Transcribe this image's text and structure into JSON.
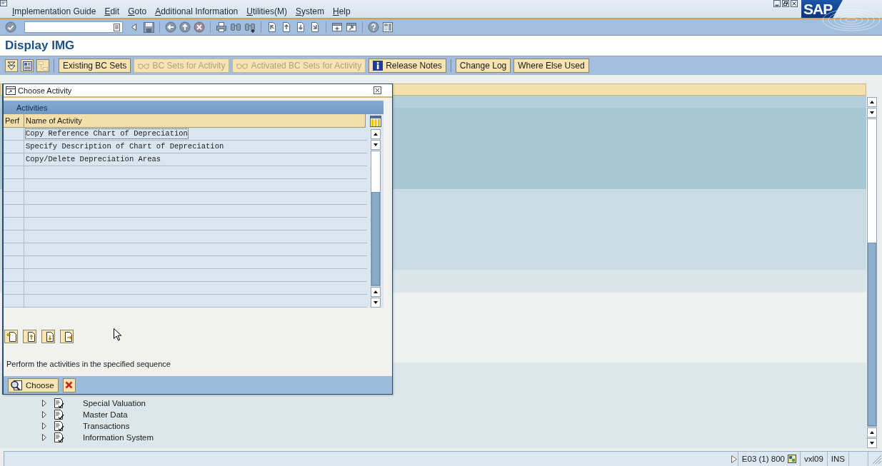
{
  "window": {
    "title": "Display IMG"
  },
  "menu_bar": {
    "items": [
      "Implementation Guide",
      "Edit",
      "Goto",
      "Additional Information",
      "Utilities(M)",
      "System",
      "Help"
    ]
  },
  "logo": {
    "text": "SAP"
  },
  "app_toolbar": {
    "groups": [
      {
        "buttons": [
          {
            "kind": "triangles",
            "disabled": false
          },
          {
            "kind": "list",
            "disabled": false
          },
          {
            "kind": "hierarchy",
            "disabled": true
          }
        ]
      },
      {
        "buttons": [
          {
            "kind": "text",
            "label": "Existing BC Sets",
            "disabled": false
          },
          {
            "kind": "bc-set",
            "label": "BC Sets for Activity",
            "disabled": true
          },
          {
            "kind": "bc-set",
            "label": "Activated BC Sets for Activity",
            "disabled": true
          },
          {
            "kind": "info",
            "label": "Release Notes",
            "disabled": false
          }
        ]
      },
      {
        "buttons": [
          {
            "kind": "text",
            "label": "Change Log",
            "disabled": false
          },
          {
            "kind": "text",
            "label": "Where Else Used",
            "disabled": false
          }
        ]
      }
    ]
  },
  "dialog": {
    "title": "Choose Activity",
    "table": {
      "title": "Activities",
      "columns": [
        "Perf",
        "Name of Activity"
      ],
      "rows": [
        {
          "name": "Copy Reference Chart of Depreciation",
          "focused": true
        },
        {
          "name": "Specify Description of Chart of Depreciation",
          "focused": false
        },
        {
          "name": "Copy/Delete Depreciation Areas",
          "focused": false
        }
      ]
    },
    "hint": "Perform the activities in the specified sequence",
    "buttons": [
      {
        "kind": "choose",
        "label": "Choose"
      },
      {
        "kind": "cancel"
      }
    ]
  },
  "tree": {
    "items": [
      {
        "label": "Special Valuation",
        "expanded": false
      },
      {
        "label": "Master Data",
        "expanded": false
      },
      {
        "label": "Transactions",
        "expanded": false
      },
      {
        "label": "Information System",
        "expanded": false
      }
    ]
  },
  "status_bar": {
    "system": "E03 (1) 800",
    "server": "vxl09",
    "mode": "INS"
  }
}
